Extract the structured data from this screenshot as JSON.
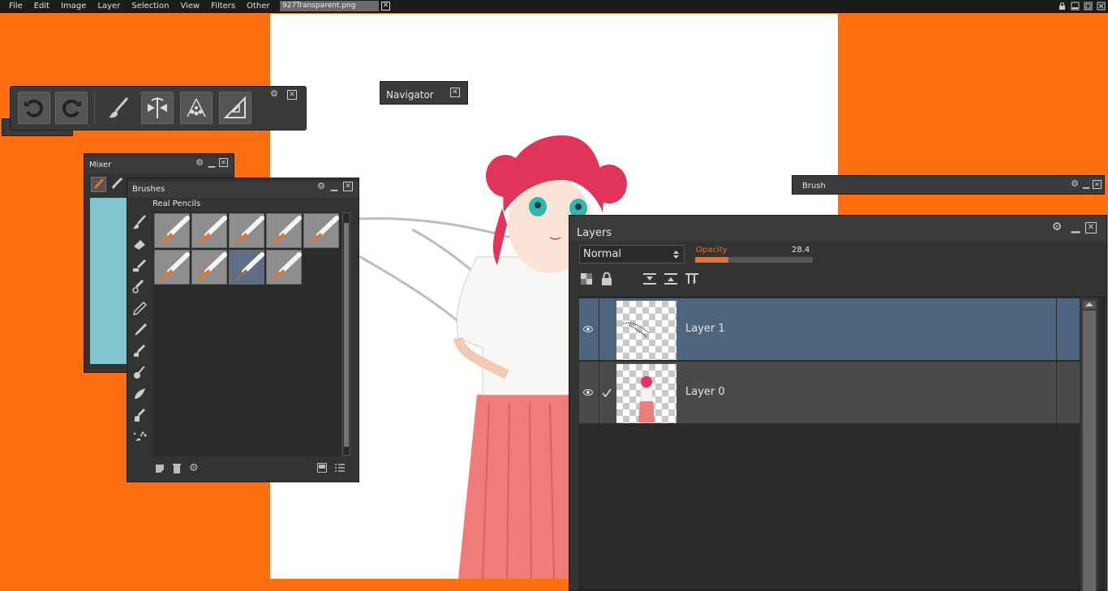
{
  "menu": [
    "File",
    "Edit",
    "Image",
    "Layer",
    "Selection",
    "View",
    "Filters",
    "Other"
  ],
  "document_tab": {
    "name": "927Transparent.png",
    "close": "✕"
  },
  "window_controls": {
    "lock": "🔒",
    "minimize": "▬",
    "maximize": "□",
    "close": "✕"
  },
  "toolbar": {
    "buttons": [
      "undo-icon",
      "redo-icon",
      "brush-icon",
      "symmetry-icon",
      "particle-icon",
      "ruler-icon"
    ],
    "settings": "⚙",
    "close": "✕"
  },
  "navigator": {
    "title": "Navigator",
    "close": "✕"
  },
  "mixer": {
    "title": "Mixer",
    "settings": "⚙",
    "minimize": "▁",
    "close": "✕",
    "color": "#7fc4cf"
  },
  "brushes": {
    "title": "Brushes",
    "category": "Real Pencils",
    "settings": "⚙",
    "minimize": "▁",
    "close": "✕",
    "tools": [
      "paint-brush-icon",
      "eraser-icon",
      "marker-icon",
      "airbrush-icon",
      "pencil-icon",
      "pen-icon",
      "smudge-icon",
      "round-brush-icon",
      "blender-icon",
      "fill-brush-icon",
      "spray-icon",
      "extra-tool-icon"
    ],
    "presets_count": 9,
    "selected_index": 7
  },
  "brush_panel": {
    "title": "Brush",
    "settings": "⚙",
    "minimize": "▁",
    "close": "✕"
  },
  "layers": {
    "title": "Layers",
    "settings": "⚙",
    "minimize": "▁",
    "close": "✕",
    "blend_mode": "Normal",
    "opacity_label": "Opacity",
    "opacity_value": "28.4",
    "opacity_fraction": 0.284,
    "items": [
      {
        "name": "Layer 1",
        "selected": true,
        "visible": true,
        "checked": false
      },
      {
        "name": "Layer 0",
        "selected": false,
        "visible": true,
        "checked": true
      }
    ]
  },
  "colors": {
    "background": "#ff6f0f",
    "accent": "#e8722a",
    "selection": "#4e6580"
  }
}
